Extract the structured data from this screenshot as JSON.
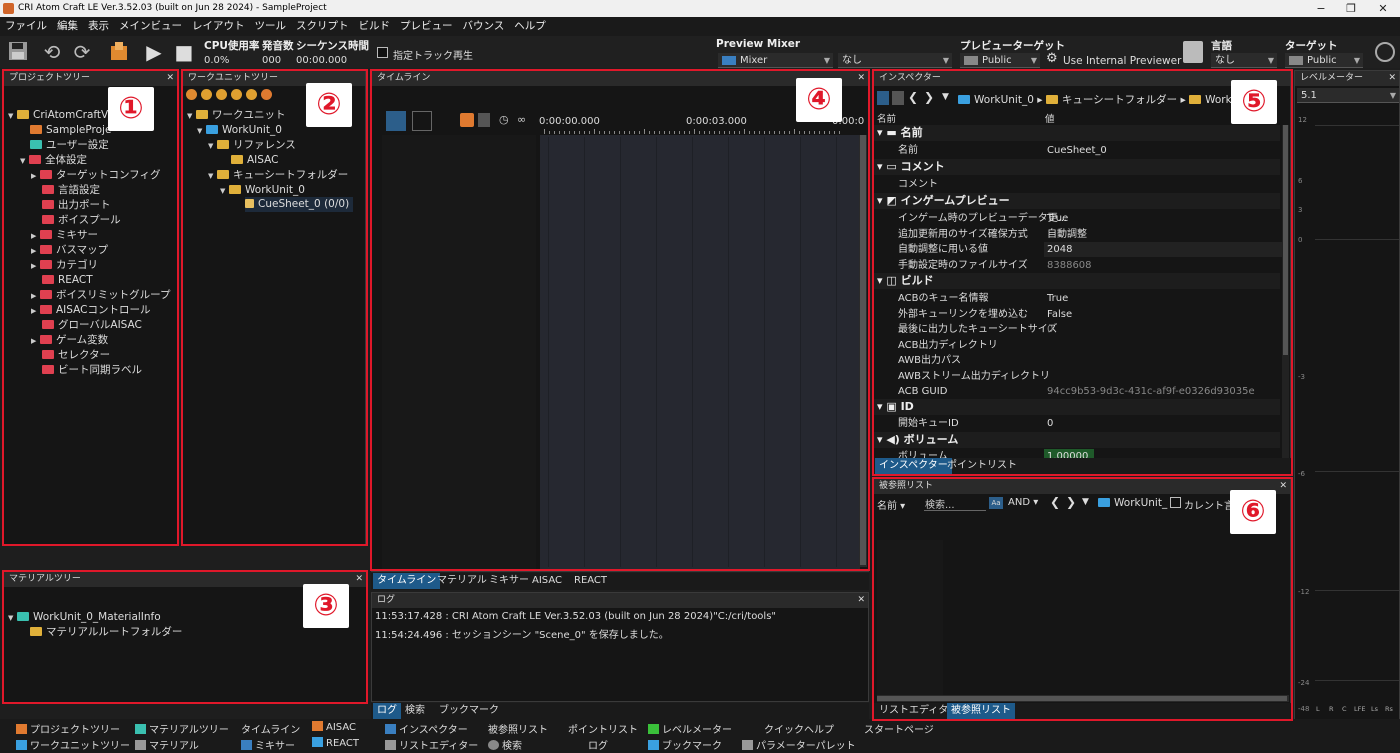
{
  "window": {
    "title": "CRI Atom Craft LE Ver.3.52.03 (built on Jun 28 2024) - SampleProject",
    "controls": [
      "−",
      "❐",
      "✕"
    ]
  },
  "menu": [
    "ファイル",
    "編集",
    "表示",
    "メインビュー",
    "レイアウト",
    "ツール",
    "スクリプト",
    "ビルド",
    "プレビュー",
    "バウンス",
    "ヘルプ"
  ],
  "toolbar": {
    "cpu_label": "CPU使用率",
    "voices_label": "発音数",
    "seq_label": "シーケンス時間",
    "cpu_value": "0.0%",
    "voices_value": "000",
    "seq_value": "00:00.000",
    "track_play": "指定トラック再生",
    "preview_mixer_label": "Preview Mixer",
    "mixer_value": "Mixer",
    "mixer_none": "なし",
    "target_label": "プレビューターゲット",
    "target_value": "Public",
    "use_internal": "Use Internal Previewer",
    "lang_label": "言語",
    "lang_value": "なし",
    "platform_label": "ターゲット",
    "platform_value": "Public"
  },
  "project_tree": {
    "title": "プロジェクトツリー",
    "items": [
      "CriAtomCraftV",
      "SampleProje",
      "ユーザー設定",
      "全体設定",
      "ターゲットコンフィグ",
      "言語設定",
      "出力ポート",
      "ボイスプール",
      "ミキサー",
      "バスマップ",
      "カテゴリ",
      "REACT",
      "ボイスリミットグループ",
      "AISACコントロール",
      "グローバルAISAC",
      "ゲーム変数",
      "セレクター",
      "ビート同期ラベル"
    ]
  },
  "workunit_tree": {
    "title": "ワークユニットツリー",
    "items": [
      "ワークユニット",
      "WorkUnit_0",
      "リファレンス",
      "AISAC",
      "キューシートフォルダー",
      "WorkUnit_0",
      "CueSheet_0 (0/0)"
    ]
  },
  "material_tree": {
    "title": "マテリアルツリー",
    "items": [
      "WorkUnit_0_MaterialInfo",
      "マテリアルルートフォルダー"
    ]
  },
  "timeline": {
    "title": "タイムライン",
    "time_labels": [
      "0:00:00.000",
      "0:00:03.000",
      "0:00:0"
    ],
    "tabs": [
      "タイムライン",
      "マテリアル",
      "ミキサー",
      "AISAC",
      "REACT"
    ]
  },
  "log": {
    "title": "ログ",
    "lines": [
      "11:53:17.428 : CRI Atom Craft LE Ver.3.52.03 (built on Jun 28 2024)\"C:/cri/tools\"",
      "11:54:24.496 : セッションシーン \"Scene_0\" を保存しました。"
    ],
    "tabs": [
      "ログ",
      "検索",
      "ブックマーク"
    ]
  },
  "inspector": {
    "title": "インスペクター",
    "breadcrumb": [
      "WorkUnit_0",
      "キューシートフォルダー",
      "WorkUni"
    ],
    "col_name": "名前",
    "col_value": "値",
    "sections": {
      "name": "名前",
      "comment": "コメント",
      "ingame": "インゲームプレビュー",
      "build": "ビルド",
      "id": "ID",
      "volume": "ボリューム"
    },
    "rows": {
      "name_k": "名前",
      "name_v": "CueSheet_0",
      "comment_k": "コメント",
      "comment_v": "",
      "ig1_k": "インゲーム時のプレビューデータ更...",
      "ig1_v": "True",
      "ig2_k": "追加更新用のサイズ確保方式",
      "ig2_v": "自動調整",
      "ig3_k": "自動調整に用いる値",
      "ig3_v": "2048",
      "ig4_k": "手動設定時のファイルサイズ",
      "ig4_v": "8388608",
      "b1_k": "ACBのキュー名情報",
      "b1_v": "True",
      "b2_k": "外部キューリンクを埋め込む",
      "b2_v": "False",
      "b3_k": "最後に出力したキューシートサイズ",
      "b3_v": "0",
      "b4_k": "ACB出力ディレクトリ",
      "b4_v": "",
      "b5_k": "AWB出力パス",
      "b5_v": "",
      "b6_k": "AWBストリーム出力ディレクトリ",
      "b6_v": "",
      "b7_k": "ACB GUID",
      "b7_v": "94cc9b53-9d3c-431c-af9f-e0326d93035e",
      "id1_k": "開始キューID",
      "id1_v": "0",
      "vol1_k": "ボリューム",
      "vol1_v": "1.00000"
    },
    "tabs": [
      "インスペクター",
      "ポイントリスト"
    ]
  },
  "ref_list": {
    "title": "被参照リスト",
    "name_filter": "名前",
    "search_placeholder": "検索...",
    "aa": "Aa",
    "and": "AND",
    "workunit": "WorkUnit_",
    "current_lang": "カレント言語",
    "tabs": [
      "リストエディター",
      "被参照リスト"
    ]
  },
  "level_meter": {
    "title": "レベルメーター",
    "mode": "5.1",
    "scale": [
      "12",
      "6",
      "3",
      "0",
      "-3",
      "-6",
      "-12",
      "-24",
      "-48"
    ],
    "channels": [
      "L",
      "R",
      "C",
      "LFE",
      "Ls",
      "Rs"
    ]
  },
  "dock": [
    "プロジェクトツリー",
    "ワークユニットツリー",
    "マテリアルツリー",
    "マテリアル",
    "タイムライン",
    "ミキサー",
    "AISAC",
    "REACT",
    "インスペクター",
    "リストエディター",
    "被参照リスト",
    "検索",
    "ポイントリスト",
    "ログ",
    "レベルメーター",
    "ブックマーク",
    "クイックヘルプ",
    "パラメーターパレット",
    "スタートページ"
  ],
  "markers": [
    "①",
    "②",
    "③",
    "④",
    "⑤",
    "⑥"
  ],
  "colors": {
    "accent": "#1e5a8a",
    "marker": "#e0182a"
  }
}
